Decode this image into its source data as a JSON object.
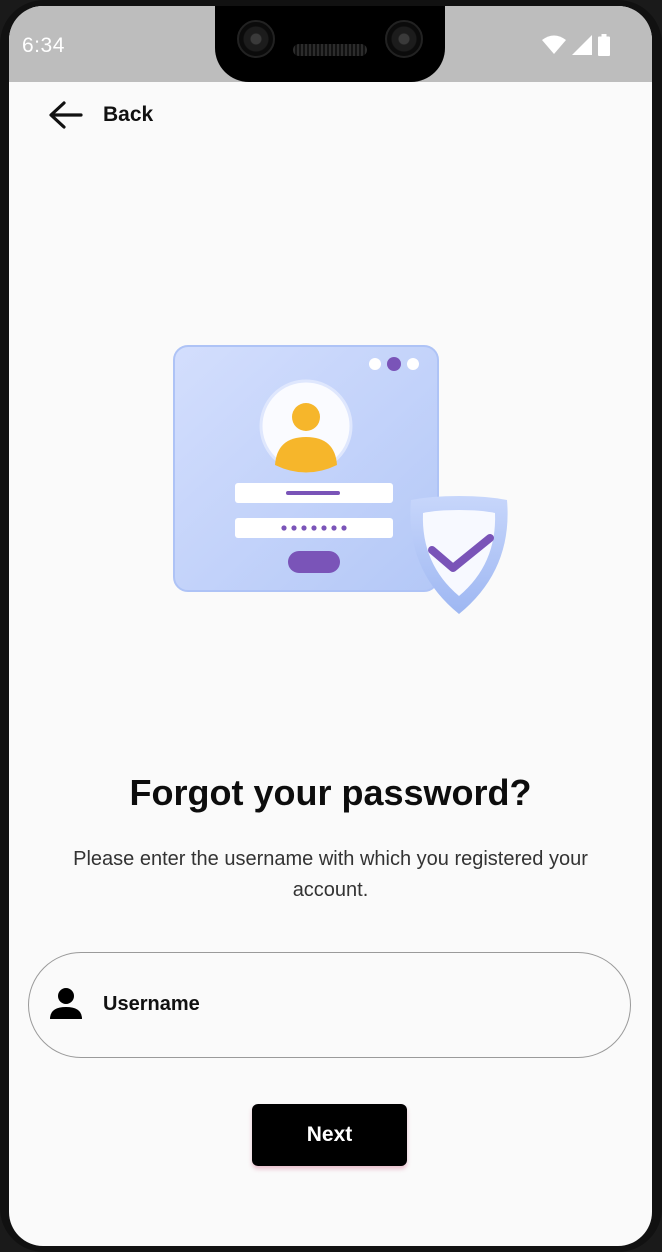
{
  "status_bar": {
    "time": "6:34",
    "icons": [
      "wifi-icon",
      "signal-icon",
      "battery-icon"
    ]
  },
  "nav": {
    "back_label": "Back",
    "back_icon": "arrow-left-icon"
  },
  "content": {
    "title": "Forgot your password?",
    "subtitle": "Please enter the username with which you registered your account."
  },
  "form": {
    "username": {
      "icon": "person-icon",
      "placeholder": "Username",
      "value": ""
    },
    "next_label": "Next"
  },
  "colors": {
    "background": "#fafafa",
    "status_bar": "#bdbdbd",
    "button": "#000000",
    "button_text": "#ffffff",
    "illustration_card": "#c3d3fb",
    "illustration_accent": "#7a54b8",
    "avatar_yellow": "#f6b62b"
  }
}
